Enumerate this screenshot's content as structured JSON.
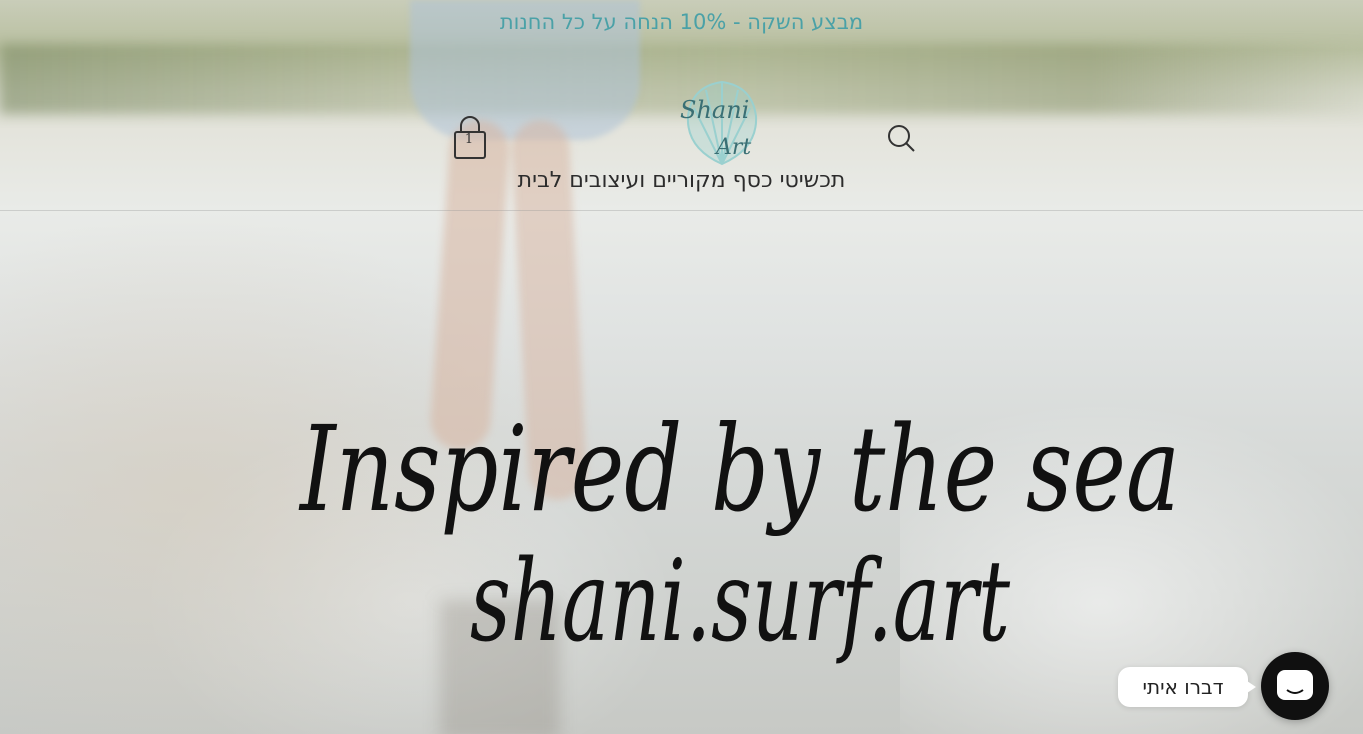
{
  "announcement": {
    "text": "מבצע השקה - 10% הנחה על כל החנות",
    "color": "#4aa1a7"
  },
  "header": {
    "cart": {
      "count": "1",
      "icon": "shopping-bag-icon"
    },
    "search": {
      "icon": "search-icon"
    },
    "logo": {
      "line1": "Shani",
      "line2": "Art",
      "color": "#3e8f92",
      "shell_color": "#9ad0cf"
    },
    "tagline": "תכשיטי כסף מקוריים ועיצובים לבית"
  },
  "hero": {
    "title_line1": "Inspired by the sea",
    "title_line2": "shani.surf.art"
  },
  "chat": {
    "label": "דברו איתי",
    "icon": "chat-icon"
  }
}
